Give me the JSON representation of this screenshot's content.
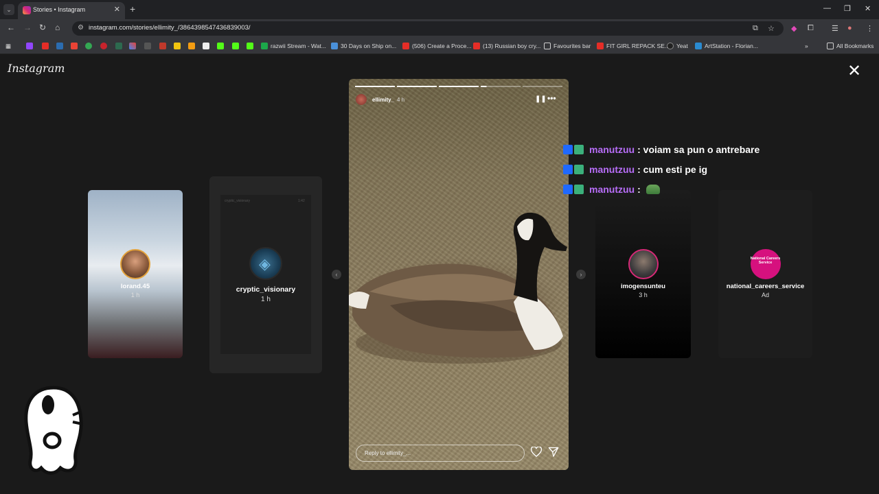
{
  "browser": {
    "tab_title": "Stories • Instagram",
    "url": "instagram.com/stories/ellimity_/3864398547436839003/",
    "bookmarks": [
      {
        "label": "razwii Stream - Wat...",
        "color": "#1ca84a"
      },
      {
        "label": "30 Days on Ship on...",
        "color": "#4a90d9"
      },
      {
        "label": "(506) Create a Proce...",
        "color": "#e52d27"
      },
      {
        "label": "(13) Russian boy cry...",
        "color": "#e52d27"
      },
      {
        "label": "Favourites bar",
        "color": "#cfcfcf"
      },
      {
        "label": "FIT GIRL REPACK SE...",
        "color": "#e52d27"
      },
      {
        "label": "Yeat",
        "color": "#222222"
      },
      {
        "label": "ArtStation - Florian...",
        "color": "#2a8bd1"
      }
    ],
    "all_bookmarks": "All Bookmarks"
  },
  "instagram": {
    "logo": "Instagram",
    "story": {
      "username": "ellimity_",
      "time": "4 h",
      "reply_placeholder": "Reply to ellimity_..."
    },
    "previews": [
      {
        "username": "lorand.45",
        "time": "1 h"
      },
      {
        "username": "cryptic_visionary",
        "time": "1 h",
        "inner_time": "1:42"
      },
      {
        "username": "imogensunteu",
        "time": "3 h"
      },
      {
        "username": "national_careers_service",
        "time": "Ad",
        "avatar_text": "National Careers Service"
      }
    ]
  },
  "chat": [
    {
      "user": "manutzuu",
      "message": ": voiam sa pun o antrebare"
    },
    {
      "user": "manutzuu",
      "message": ": cum esti pe ig"
    },
    {
      "user": "manutzuu",
      "message": ":",
      "emote": "pepe-emote"
    }
  ]
}
